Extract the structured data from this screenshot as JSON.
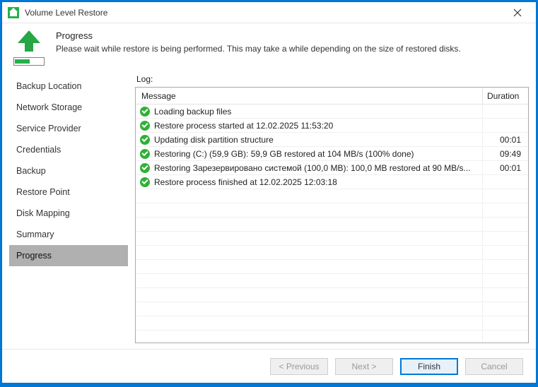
{
  "window": {
    "title": "Volume Level Restore"
  },
  "header": {
    "heading": "Progress",
    "sub": "Please wait while restore is being performed. This may take a while depending on the size of restored disks."
  },
  "sidebar": {
    "items": [
      {
        "label": "Backup Location"
      },
      {
        "label": "Network Storage"
      },
      {
        "label": "Service Provider"
      },
      {
        "label": "Credentials"
      },
      {
        "label": "Backup"
      },
      {
        "label": "Restore Point"
      },
      {
        "label": "Disk Mapping"
      },
      {
        "label": "Summary"
      },
      {
        "label": "Progress"
      }
    ],
    "selectedIndex": 8
  },
  "log": {
    "label": "Log:",
    "columns": {
      "message": "Message",
      "duration": "Duration"
    },
    "rows": [
      {
        "status": "ok",
        "message": "Loading backup files",
        "duration": ""
      },
      {
        "status": "ok",
        "message": "Restore process started at 12.02.2025 11:53:20",
        "duration": ""
      },
      {
        "status": "ok",
        "message": "Updating disk partition structure",
        "duration": "00:01"
      },
      {
        "status": "ok",
        "message": "Restoring (C:) (59,9 GB): 59,9 GB restored at 104 MB/s (100% done)",
        "duration": "09:49"
      },
      {
        "status": "ok",
        "message": "Restoring Зарезервировано системой (100,0 MB): 100,0 MB restored at 90 MB/s...",
        "duration": "00:01"
      },
      {
        "status": "ok",
        "message": "Restore process finished at 12.02.2025 12:03:18",
        "duration": ""
      }
    ]
  },
  "footer": {
    "previous": "< Previous",
    "next": "Next >",
    "finish": "Finish",
    "cancel": "Cancel"
  }
}
